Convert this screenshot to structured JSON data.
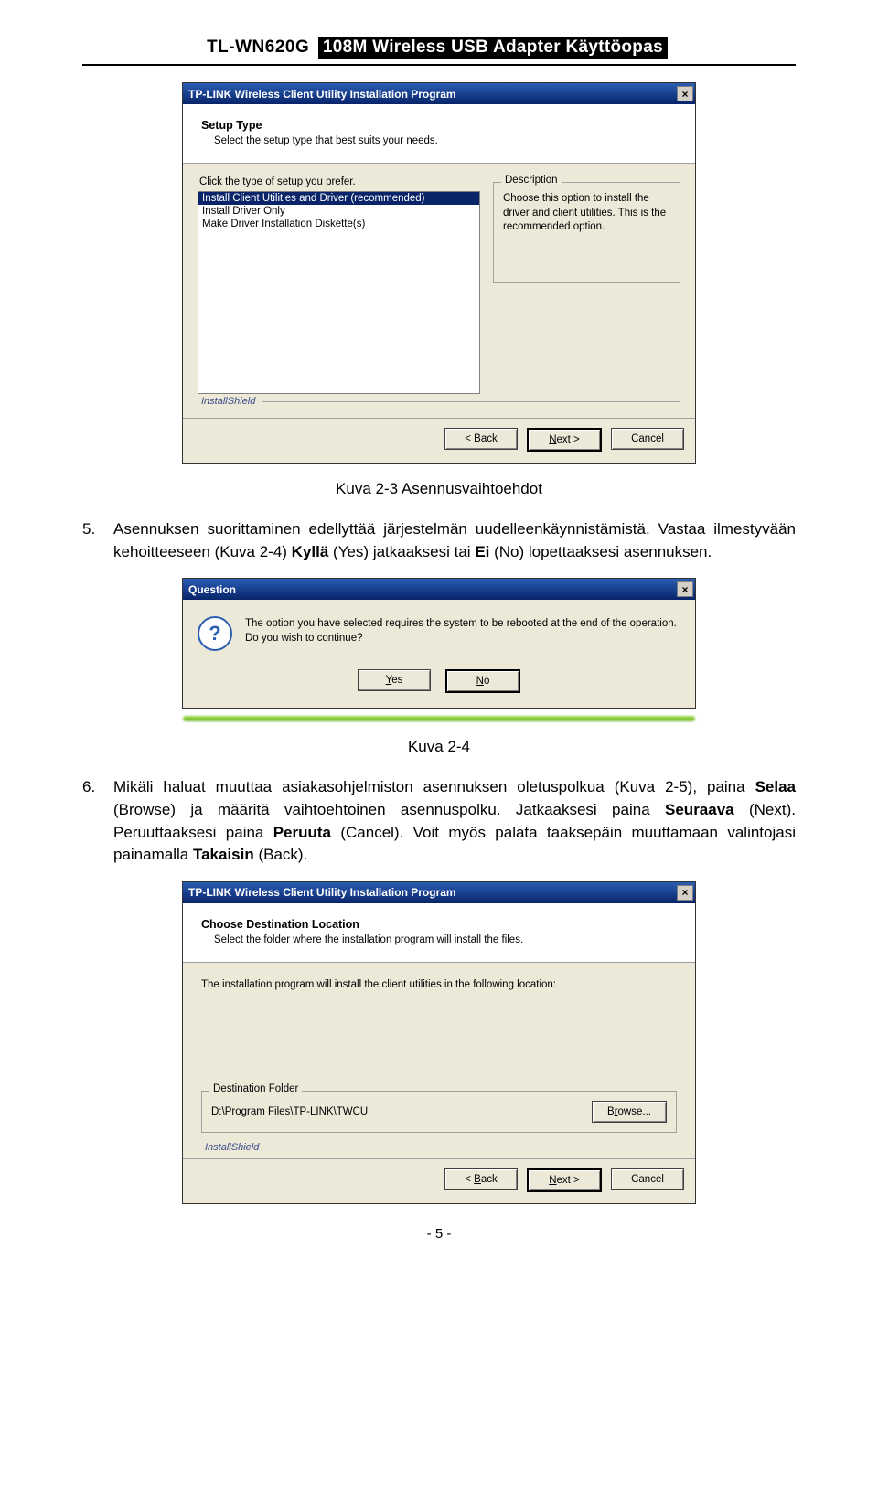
{
  "header": {
    "model": "TL-WN620G",
    "title": "108M Wireless USB Adapter Käyttöopas"
  },
  "setup_dialog": {
    "title": "TP-LINK Wireless Client Utility Installation Program",
    "heading": "Setup Type",
    "subheading": "Select the setup type that best suits your needs.",
    "list_label": "Click the type of setup you prefer.",
    "items": [
      "Install Client Utilities and Driver (recommended)",
      "Install Driver Only",
      "Make Driver Installation Diskette(s)"
    ],
    "desc_label": "Description",
    "desc_text": "Choose this option to install the driver and client utilities. This is the recommended option.",
    "installshield": "InstallShield",
    "btn_back": "< Back",
    "btn_next": "Next >",
    "btn_cancel": "Cancel"
  },
  "caption1": "Kuva 2-3  Asennusvaihtoehdot",
  "para5": {
    "num": "5.",
    "text_a": "Asennuksen suorittaminen edellyttää järjestelmän uudelleenkäynnistämistä. Vastaa ilmestyvään kehoitteeseen (Kuva 2-4) ",
    "bold1": "Kyllä",
    "text_b": " (Yes) jatkaaksesi tai ",
    "bold2": "Ei",
    "text_c": " (No) lopettaaksesi asennuksen."
  },
  "question_dialog": {
    "title": "Question",
    "text": "The option you have selected requires the system to be rebooted at the end of the operation. Do you wish to continue?",
    "btn_yes": "Yes",
    "btn_no": "No"
  },
  "caption2": "Kuva 2-4",
  "para6": {
    "num": "6.",
    "text_a": "Mikäli haluat muuttaa asiakasohjelmiston asennuksen oletuspolkua (Kuva 2-5), paina ",
    "bold1": "Selaa",
    "text_b": " (Browse) ja määritä vaihtoehtoinen asennuspolku. Jatkaaksesi paina ",
    "bold2": "Seuraava",
    "text_c": " (Next). Peruuttaaksesi paina ",
    "bold3": "Peruuta",
    "text_d": " (Cancel). Voit myös palata taaksepäin muuttamaan valintojasi painamalla ",
    "bold4": "Takaisin",
    "text_e": " (Back)."
  },
  "dest_dialog": {
    "title": "TP-LINK Wireless Client Utility Installation Program",
    "heading": "Choose Destination Location",
    "subheading": "Select the folder where the installation program will install the files.",
    "body_text": "The installation program will install the client utilities in the following location:",
    "folder_label": "Destination Folder",
    "folder_path": "D:\\Program Files\\TP-LINK\\TWCU",
    "browse": "Browse...",
    "installshield": "InstallShield",
    "btn_back": "< Back",
    "btn_next": "Next >",
    "btn_cancel": "Cancel"
  },
  "page_num": "- 5 -"
}
